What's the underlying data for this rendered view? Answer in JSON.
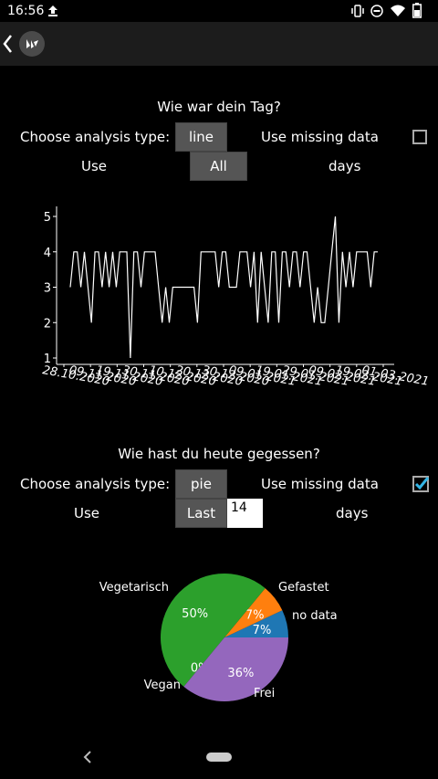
{
  "status": {
    "time": "16:56",
    "icons": [
      "upload-arrow-icon",
      "vibrate-icon",
      "do-not-disturb-icon",
      "wifi-icon",
      "battery-icon"
    ]
  },
  "toolbar": {
    "back_icon": "back-chevron-icon",
    "logo_icon": "kivy-logo-icon"
  },
  "section1": {
    "question": "Wie war dein Tag?",
    "analysis_label": "Choose analysis type:",
    "analysis_value": "line",
    "missing_label": "Use missing data",
    "missing_checked": false,
    "use_label": "Use",
    "range_value": "All",
    "days_label": "days"
  },
  "section2": {
    "question": "Wie hast du heute gegessen?",
    "analysis_label": "Choose analysis type:",
    "analysis_value": "pie",
    "missing_label": "Use missing data",
    "missing_checked": true,
    "use_label": "Use",
    "range_value": "Last",
    "days_input_value": "14",
    "days_label": "days"
  },
  "chart_data": [
    {
      "type": "line",
      "ylim": [
        1,
        5
      ],
      "yticks": [
        "1",
        "2",
        "3",
        "4",
        "5"
      ],
      "xtick_labels_rendered": "28.10.2020 09.11.2020 19.11.2020 30.11.2020 10.12.2020 20.12.2020 30.12.2020 09.01.2021 19.01.2021 29.01.2021 09.02.2021 19.02.2021 01.03.2021",
      "xtick_labels": [
        "28.10.2020",
        "09.11.2020",
        "19.11.2020",
        "30.11.2020",
        "10.12.2020",
        "20.12.2020",
        "30.12.2020",
        "09.01.2021",
        "19.01.2021",
        "29.01.2021",
        "09.02.2021",
        "19.02.2021",
        "01.03.2021"
      ],
      "color": "#ffffff",
      "values": [
        3,
        4,
        4,
        3,
        4,
        3,
        2,
        4,
        4,
        3,
        4,
        3,
        4,
        3,
        4,
        4,
        4,
        1,
        4,
        4,
        3,
        4,
        4,
        4,
        4,
        3,
        2,
        3,
        2,
        3,
        3,
        3,
        3,
        3,
        3,
        3,
        2,
        4,
        4,
        4,
        4,
        4,
        3,
        4,
        4,
        3,
        3,
        3,
        4,
        4,
        4,
        3,
        4,
        2,
        4,
        3,
        2,
        4,
        4,
        2,
        4,
        4,
        3,
        4,
        4,
        3,
        4,
        4,
        3,
        2,
        3,
        2,
        2,
        3,
        4,
        5,
        2,
        4,
        3,
        4,
        3,
        4,
        4,
        4,
        4,
        3,
        4,
        4
      ]
    },
    {
      "type": "pie",
      "slices": [
        {
          "label": "no data",
          "value": 7,
          "pct": "7%",
          "color": "#1f77b4"
        },
        {
          "label": "Gefastet",
          "value": 7,
          "pct": "7%",
          "color": "#ff7f0e"
        },
        {
          "label": "Vegetarisch",
          "value": 50,
          "pct": "50%",
          "color": "#2ca02c"
        },
        {
          "label": "Vegan",
          "value": 0,
          "pct": "0%",
          "color": "#d62728"
        },
        {
          "label": "Frei",
          "value": 36,
          "pct": "36%",
          "color": "#9467bd"
        }
      ]
    }
  ],
  "navbar": {
    "back_icon": "nav-back-icon",
    "home_icon": "nav-home-pill-icon"
  }
}
